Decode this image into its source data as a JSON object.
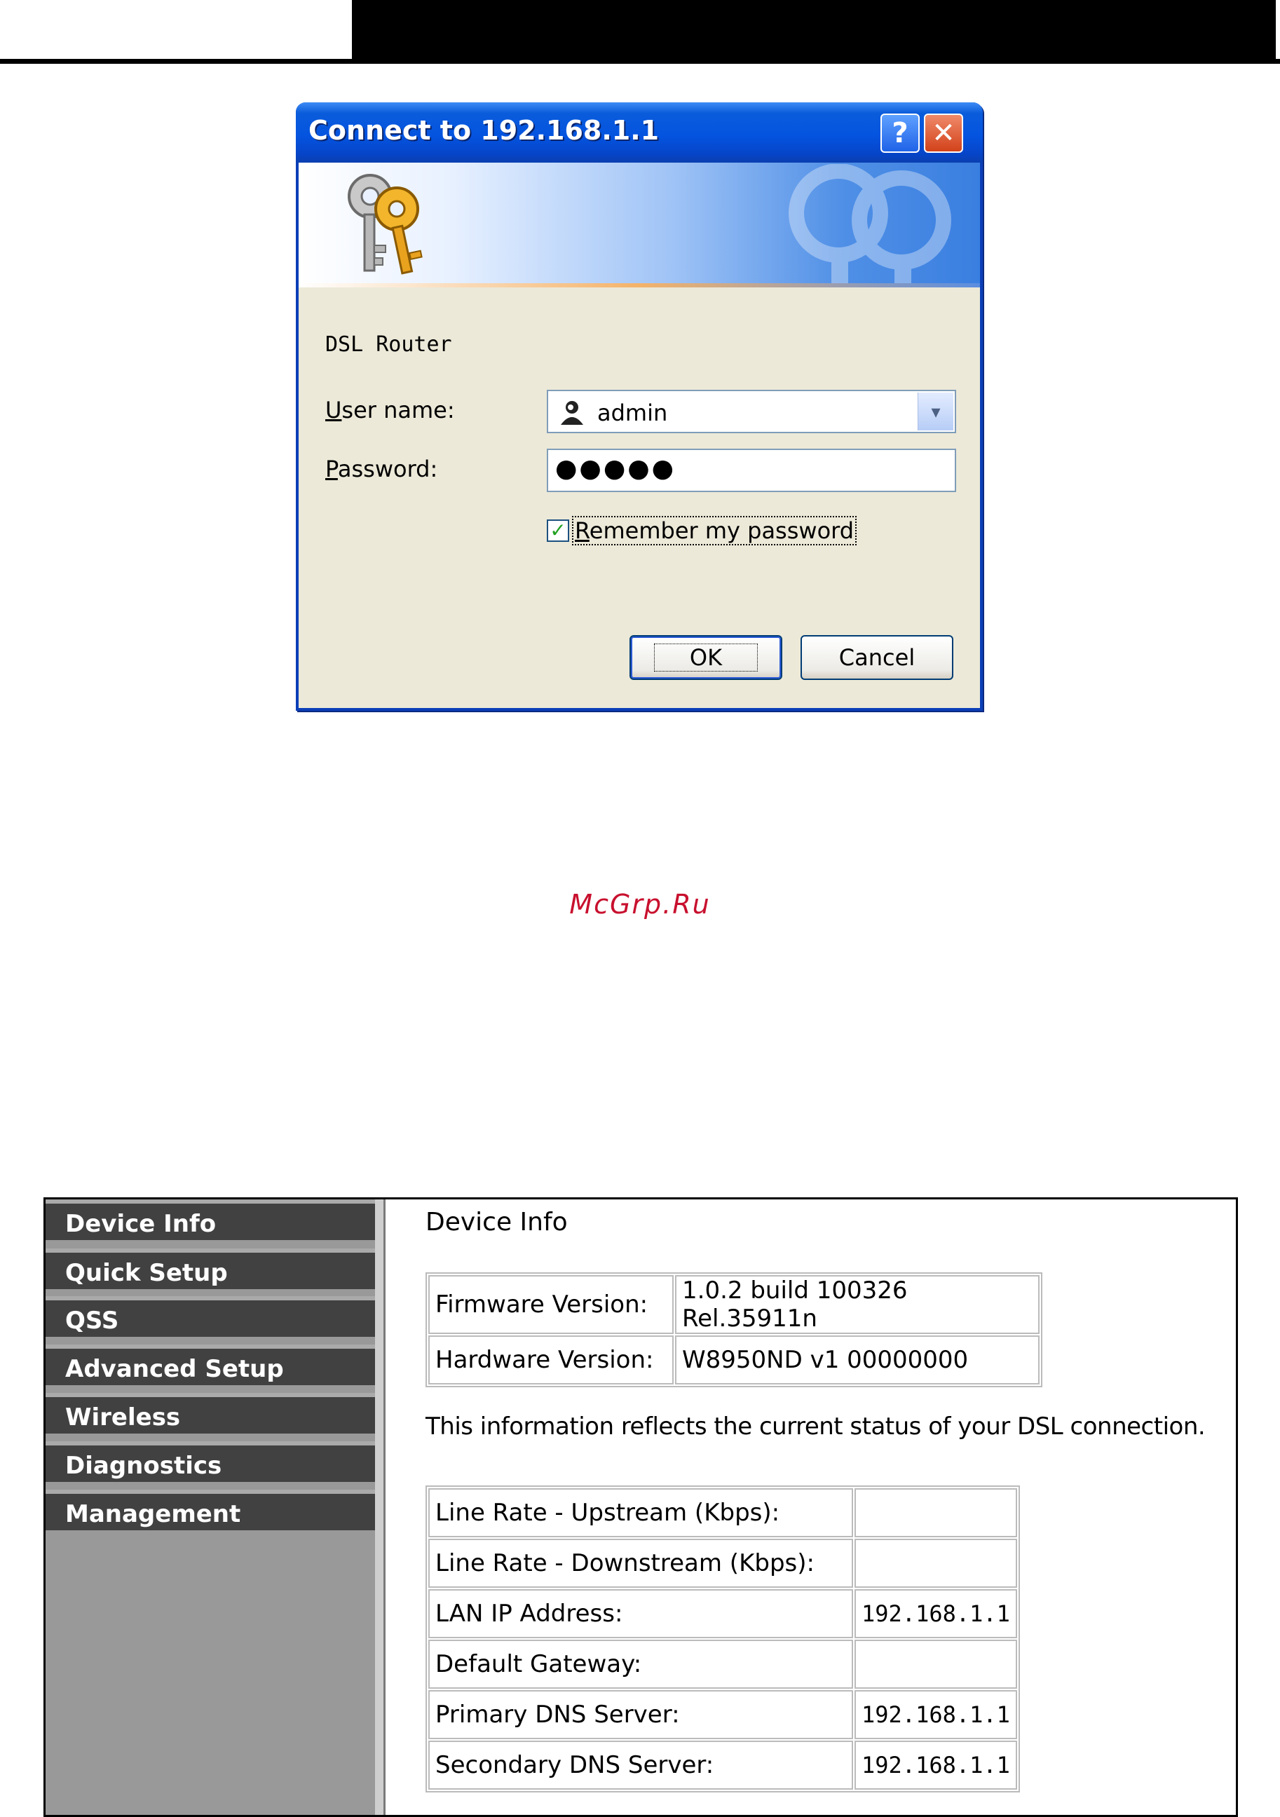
{
  "dialog": {
    "title": "Connect to 192.168.1.1",
    "help_label": "?",
    "close_label": "✕",
    "realm": "DSL Router",
    "username_label_accel": "U",
    "username_label_rest": "ser name:",
    "username_value": "admin",
    "password_label_accel": "P",
    "password_label_rest": "assword:",
    "password_value": "●●●●●",
    "remember_checked": true,
    "remember_label_accel": "R",
    "remember_label_rest": "emember my password",
    "ok_label": "OK",
    "cancel_label": "Cancel",
    "icons": [
      "keys-icon",
      "user-icon",
      "chevron-down-icon",
      "checkmark-icon"
    ]
  },
  "watermark": "McGrp.Ru",
  "router": {
    "menu": [
      {
        "label": "Device Info"
      },
      {
        "label": "Quick Setup"
      },
      {
        "label": "QSS"
      },
      {
        "label": "Advanced Setup"
      },
      {
        "label": "Wireless"
      },
      {
        "label": "Diagnostics"
      },
      {
        "label": "Management"
      }
    ],
    "page_title": "Device Info",
    "version_rows": [
      {
        "key": "Firmware Version:",
        "value": "1.0.2 build 100326 Rel.35911n"
      },
      {
        "key": "Hardware Version:",
        "value": "W8950ND v1 00000000"
      }
    ],
    "description": "This information reflects the current status of your DSL connection.",
    "status_rows": [
      {
        "key": "Line Rate - Upstream (Kbps):",
        "value": ""
      },
      {
        "key": "Line Rate - Downstream (Kbps):",
        "value": ""
      },
      {
        "key": "LAN IP Address:",
        "value": "192.168.1.1"
      },
      {
        "key": "Default Gateway:",
        "value": ""
      },
      {
        "key": "Primary DNS Server:",
        "value": "192.168.1.1"
      },
      {
        "key": "Secondary DNS Server:",
        "value": "192.168.1.1"
      }
    ]
  },
  "colors": {
    "titlebar": "#0454e0",
    "menu_bg": "#414141",
    "sidebar_bg": "#999999",
    "watermark": "#c8102e"
  }
}
